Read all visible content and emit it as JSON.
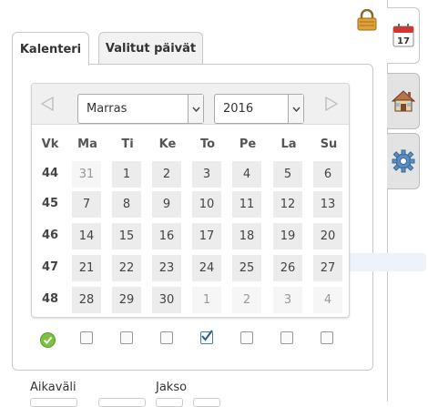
{
  "tabs": [
    {
      "label": "Kalenteri",
      "active": true
    },
    {
      "label": "Valitut päivät",
      "active": false
    }
  ],
  "side_tabs": [
    {
      "icon": "calendar-icon",
      "day": "17"
    },
    {
      "icon": "home-icon"
    },
    {
      "icon": "gear-icon"
    }
  ],
  "lock_icon": "lock-icon",
  "calendar": {
    "month": "Marras",
    "year": "2016",
    "headers": [
      "Vk",
      "Ma",
      "Ti",
      "Ke",
      "To",
      "Pe",
      "La",
      "Su"
    ],
    "weeks": [
      {
        "wk": "44",
        "days": [
          "31",
          "1",
          "2",
          "3",
          "4",
          "5",
          "6"
        ],
        "other": [
          true,
          false,
          false,
          false,
          false,
          false,
          false
        ]
      },
      {
        "wk": "45",
        "days": [
          "7",
          "8",
          "9",
          "10",
          "11",
          "12",
          "13"
        ],
        "other": [
          false,
          false,
          false,
          false,
          false,
          false,
          false
        ]
      },
      {
        "wk": "46",
        "days": [
          "14",
          "15",
          "16",
          "17",
          "18",
          "19",
          "20"
        ],
        "other": [
          false,
          false,
          false,
          false,
          false,
          false,
          false
        ]
      },
      {
        "wk": "47",
        "days": [
          "21",
          "22",
          "23",
          "24",
          "25",
          "26",
          "27"
        ],
        "other": [
          false,
          false,
          false,
          false,
          false,
          false,
          false
        ]
      },
      {
        "wk": "48",
        "days": [
          "28",
          "29",
          "30",
          "1",
          "2",
          "3",
          "4"
        ],
        "other": [
          false,
          false,
          false,
          true,
          true,
          true,
          true
        ]
      }
    ]
  },
  "weekday_checks": [
    false,
    false,
    false,
    true,
    false,
    false,
    false
  ],
  "bottom": {
    "interval_label": "Aikaväli",
    "period_label": "Jakso"
  },
  "colors": {
    "accent": "#4a7fa9",
    "ok": "#7cc242"
  }
}
